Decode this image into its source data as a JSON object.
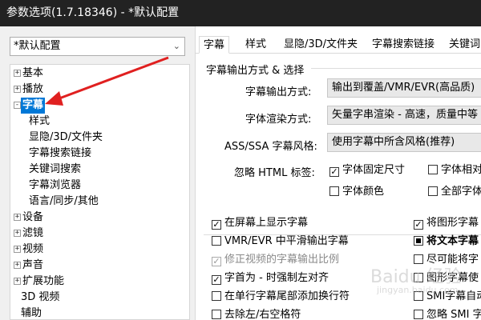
{
  "window": {
    "title": "参数选项(1.7.18346) - *默认配置"
  },
  "preset": {
    "value": "*默认配置"
  },
  "tree": [
    {
      "label": "基本",
      "expander": "+"
    },
    {
      "label": "播放",
      "expander": "+"
    },
    {
      "label": "字幕",
      "expander": "-",
      "selected": true
    },
    {
      "label": "样式"
    },
    {
      "label": "显隐/3D/文件夹"
    },
    {
      "label": "字幕搜索链接"
    },
    {
      "label": "关键词搜索"
    },
    {
      "label": "字幕浏览器"
    },
    {
      "label": "语言/同步/其他"
    },
    {
      "label": "设备",
      "expander": "+"
    },
    {
      "label": "滤镜",
      "expander": "+"
    },
    {
      "label": "视频",
      "expander": "+"
    },
    {
      "label": "声音",
      "expander": "+"
    },
    {
      "label": "扩展功能",
      "expander": "+"
    },
    {
      "label": "3D 视频"
    },
    {
      "label": "辅助"
    }
  ],
  "tabs": [
    "字幕",
    "样式",
    "显隐/3D/文件夹",
    "字幕搜索链接",
    "关键词"
  ],
  "section": {
    "title": "字幕输出方式 & 选择"
  },
  "settings": {
    "output_label": "字幕输出方式:",
    "output_value": "输出到覆盖/VMR/EVR(高品质)",
    "render_label": "字体渲染方式:",
    "render_value": "矢量字串渲染 - 高速，质量中等",
    "ass_label": "ASS/SSA 字幕风格:",
    "ass_value": "使用字幕中所含风格(推荐)",
    "html_label": "忽略 HTML 标签:"
  },
  "html_options": [
    {
      "label": "字体固定尺寸",
      "checked": true
    },
    {
      "label": "字体相对",
      "checked": false
    },
    {
      "label": "字体颜色",
      "checked": false
    },
    {
      "label": "全部字体",
      "checked": false
    }
  ],
  "left_options": [
    {
      "label": "在屏幕上显示字幕",
      "checked": true,
      "disabled": false
    },
    {
      "label": "VMR/EVR 中平滑输出字幕",
      "checked": false,
      "disabled": false
    },
    {
      "label": "修正视频的字幕输出比例",
      "checked": true,
      "disabled": true
    },
    {
      "label": "字首为 - 时强制左对齐",
      "checked": true,
      "disabled": false
    },
    {
      "label": "在单行字幕尾部添加换行符",
      "checked": false,
      "disabled": false
    },
    {
      "label": "去除左/右空格符",
      "checked": false,
      "disabled": false
    }
  ],
  "right_options": [
    {
      "label": "将图形字幕",
      "state": "checked"
    },
    {
      "label": "将文本字幕",
      "state": "filled"
    },
    {
      "label": "尽可能将字",
      "state": "unchecked"
    },
    {
      "label": "图形字幕使",
      "state": "unchecked"
    },
    {
      "label": "SMI字幕自动",
      "state": "unchecked"
    },
    {
      "label": "忽略 SMI 字",
      "state": "unchecked"
    }
  ],
  "watermark": {
    "text": "Baidu 经验",
    "sub": "jingyan.baidu.com"
  },
  "colors": {
    "selection": "#0078d7",
    "arrow": "#e02020",
    "titlebar": "#222222"
  }
}
